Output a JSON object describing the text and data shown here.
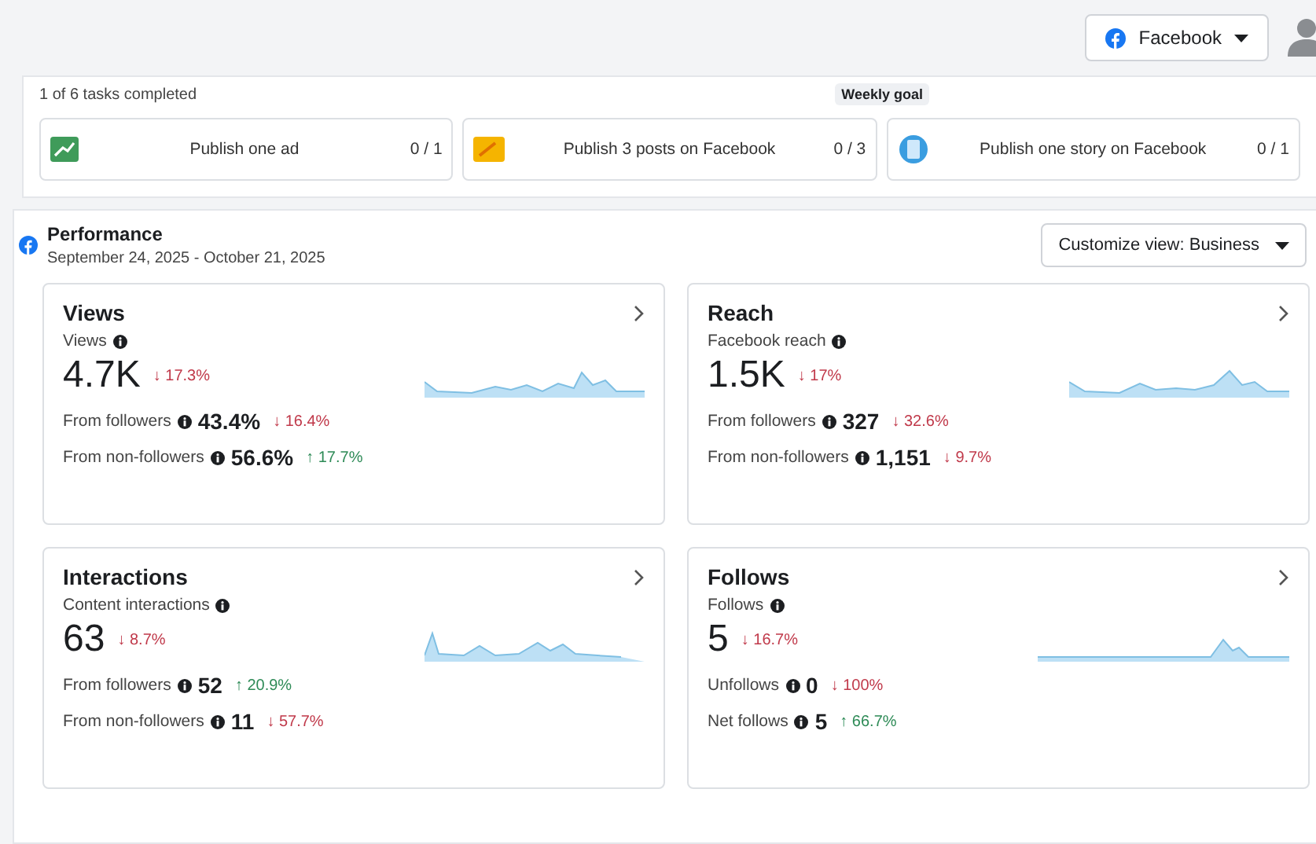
{
  "header": {
    "account_button": "Facebook"
  },
  "goals": {
    "progress": "1 of 6 tasks completed",
    "badge": "Weekly goal",
    "tasks": [
      {
        "kind": "ad",
        "label": "Publish one ad",
        "count": "0 / 1"
      },
      {
        "kind": "post",
        "label": "Publish 3 posts on Facebook",
        "count": "0 / 3"
      },
      {
        "kind": "story",
        "label": "Publish one story on Facebook",
        "count": "0 / 1"
      }
    ]
  },
  "performance": {
    "title": "Performance",
    "date_range": "September 24, 2025 - October 21, 2025",
    "customize_button": "Customize view: Business",
    "cards": [
      {
        "title": "Views",
        "metric_label": "Views",
        "value": "4.7K",
        "change": "↓ 17.3%",
        "kind": "down",
        "rows": [
          {
            "label": "From followers",
            "value": "43.4%",
            "change": "↓ 16.4%",
            "kind": "down"
          },
          {
            "label": "From non-followers",
            "value": "56.6%",
            "change": "↑ 17.7%",
            "kind": "up"
          }
        ]
      },
      {
        "title": "Reach",
        "metric_label": "Facebook reach",
        "value": "1.5K",
        "change": "↓ 17%",
        "kind": "down",
        "rows": [
          {
            "label": "From followers",
            "value": "327",
            "change": "↓ 32.6%",
            "kind": "down"
          },
          {
            "label": "From non-followers",
            "value": "1,151",
            "change": "↓ 9.7%",
            "kind": "down"
          }
        ]
      },
      {
        "title": "Interactions",
        "metric_label": "Content interactions",
        "value": "63",
        "change": "↓ 8.7%",
        "kind": "down",
        "rows": [
          {
            "label": "From followers",
            "value": "52",
            "change": "↑ 20.9%",
            "kind": "up"
          },
          {
            "label": "From non-followers",
            "value": "11",
            "change": "↓ 57.7%",
            "kind": "down"
          }
        ]
      },
      {
        "title": "Follows",
        "metric_label": "Follows",
        "value": "5",
        "change": "↓ 16.7%",
        "kind": "down",
        "rows": [
          {
            "label": "Unfollows",
            "value": "0",
            "change": "↓ 100%",
            "kind": "down"
          },
          {
            "label": "Net follows",
            "value": "5",
            "change": "↑ 66.7%",
            "kind": "up"
          }
        ]
      }
    ]
  }
}
